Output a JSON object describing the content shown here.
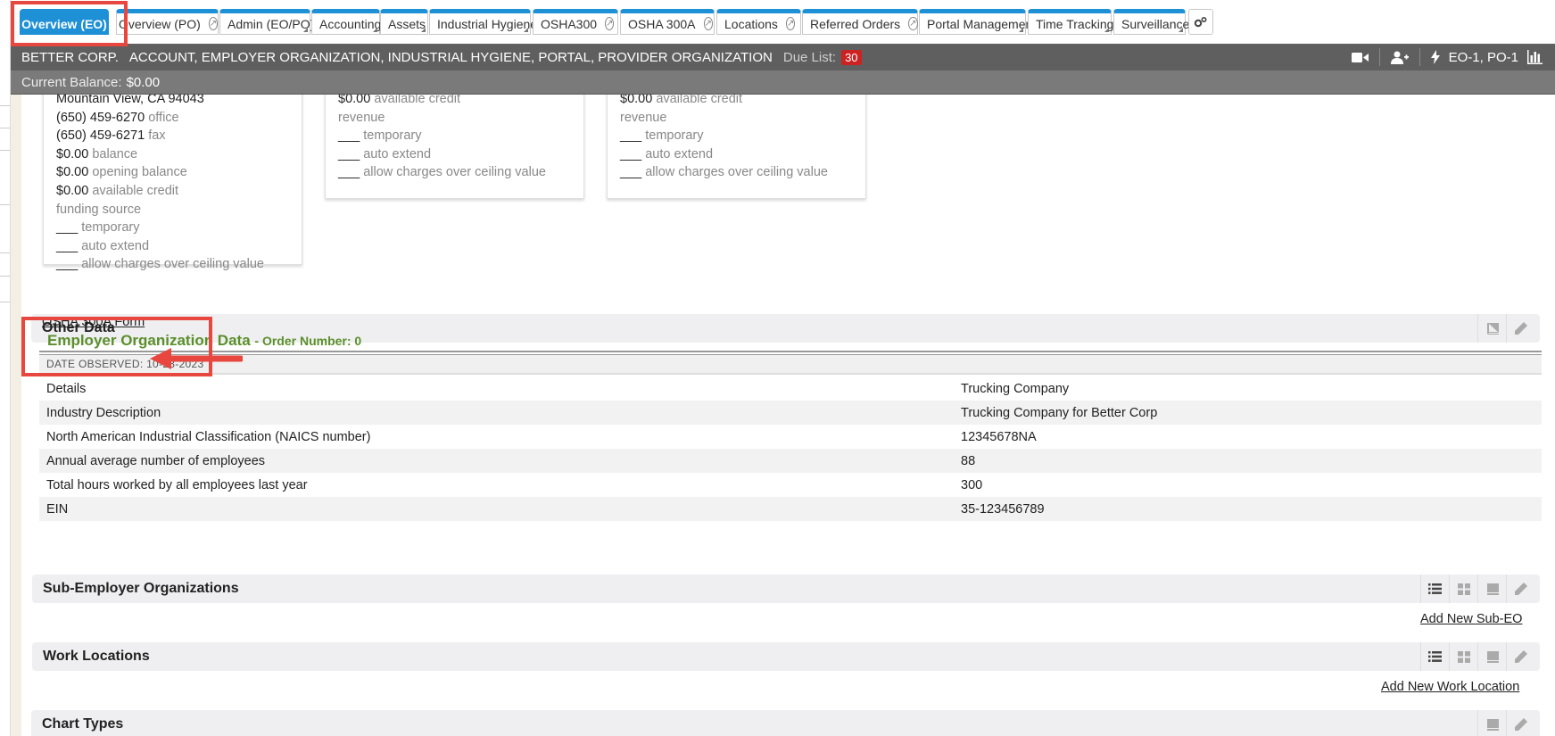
{
  "tabs": [
    {
      "label": "Overview (EO)",
      "active": true,
      "circle": false
    },
    {
      "label": "Overview (PO)",
      "circle": true
    },
    {
      "label": "Admin (EO/PO)",
      "circle": false
    },
    {
      "label": "Accounting",
      "circle": false
    },
    {
      "label": "Assets",
      "circle": false
    },
    {
      "label": "Industrial Hygiene",
      "circle": false
    },
    {
      "label": "OSHA300",
      "circle": true
    },
    {
      "label": "OSHA 300A",
      "circle": true
    },
    {
      "label": "Locations",
      "circle": true
    },
    {
      "label": "Referred Orders",
      "circle": true
    },
    {
      "label": "Portal Management",
      "circle": false
    },
    {
      "label": "Time Tracking",
      "circle": false
    },
    {
      "label": "Surveillance",
      "circle": false
    }
  ],
  "header": {
    "company": "BETTER CORP.",
    "roles": "ACCOUNT, EMPLOYER ORGANIZATION, INDUSTRIAL HYGIENE, PORTAL, PROVIDER ORGANIZATION",
    "due_list_label": "Due List:",
    "due_list_count": "30",
    "right_label": "EO-1, PO-1",
    "balance_label": "Current Balance:",
    "balance_value": "$0.00"
  },
  "card1": {
    "address": "Mountain View, CA 94043",
    "office_value": "(650) 459-6270",
    "office_label": "office",
    "fax_value": "(650) 459-6271",
    "fax_label": "fax",
    "balance_value": "$0.00",
    "balance_label": "balance",
    "opening_value": "$0.00",
    "opening_label": "opening balance",
    "credit_value": "$0.00",
    "credit_label": "available credit",
    "funding": "funding source",
    "blank": "___",
    "temporary": "temporary",
    "auto_extend": "auto extend",
    "allow": "allow charges over ceiling value"
  },
  "card2": {
    "credit_value": "$0.00",
    "credit_label": "available credit",
    "revenue": "revenue",
    "blank": "___",
    "temporary": "temporary",
    "auto_extend": "auto extend",
    "allow": "allow charges over ceiling value"
  },
  "card3": {
    "credit_value": "$0.00",
    "credit_label": "available credit",
    "revenue": "revenue",
    "blank": "___",
    "temporary": "temporary",
    "auto_extend": "auto extend",
    "allow": "allow charges over ceiling value"
  },
  "other_data": {
    "title": "Other Data",
    "link": "OSHA 300A Form"
  },
  "eo_data": {
    "title": "Employer Organization Data",
    "order": "- Order Number: 0",
    "date_observed": "DATE OBSERVED: 10-23-2023",
    "rows": [
      {
        "label": "Details",
        "value": "Trucking Company"
      },
      {
        "label": "Industry Description",
        "value": "Trucking Company for Better Corp"
      },
      {
        "label": "North American Industrial Classification (NAICS number)",
        "value": "12345678NA"
      },
      {
        "label": "Annual average number of employees",
        "value": "88"
      },
      {
        "label": "Total hours worked by all employees last year",
        "value": "300"
      },
      {
        "label": "EIN",
        "value": "35-123456789"
      }
    ]
  },
  "sub_eo": {
    "title": "Sub-Employer Organizations",
    "link": "Add New Sub-EO"
  },
  "work_locations": {
    "title": "Work Locations",
    "link": "Add New Work Location"
  },
  "chart_types": {
    "title": "Chart Types"
  },
  "colors": {
    "tab_accent": "#1e90d5",
    "header_dark": "#5f5f5f",
    "header_light": "#7a7a7a",
    "eo_green": "#5a8f2a",
    "annotation_red": "#e8473f",
    "badge_red": "#cc2222"
  }
}
